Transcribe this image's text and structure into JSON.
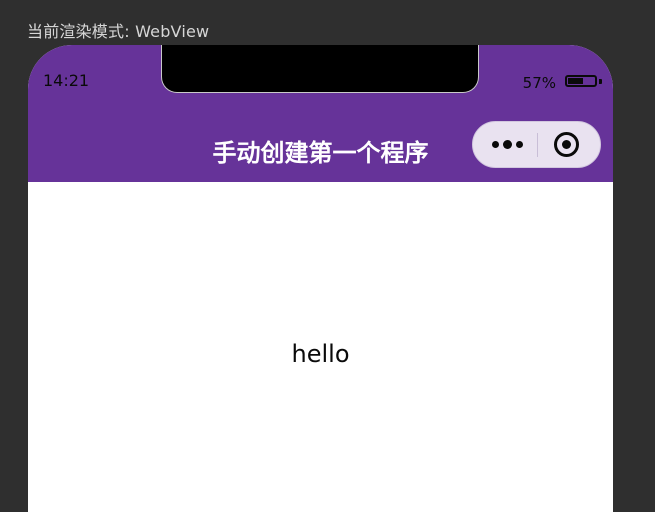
{
  "top_label": "当前渲染模式: WebView",
  "status_bar": {
    "time": "14:21",
    "battery_text": "57%",
    "battery_level": 0.57
  },
  "nav": {
    "title": "手动创建第一个程序",
    "background_color": "#663399",
    "capsule": {
      "more_icon": "more-dots-icon",
      "close_icon": "target-circle-icon"
    }
  },
  "content": {
    "text": "hello"
  }
}
